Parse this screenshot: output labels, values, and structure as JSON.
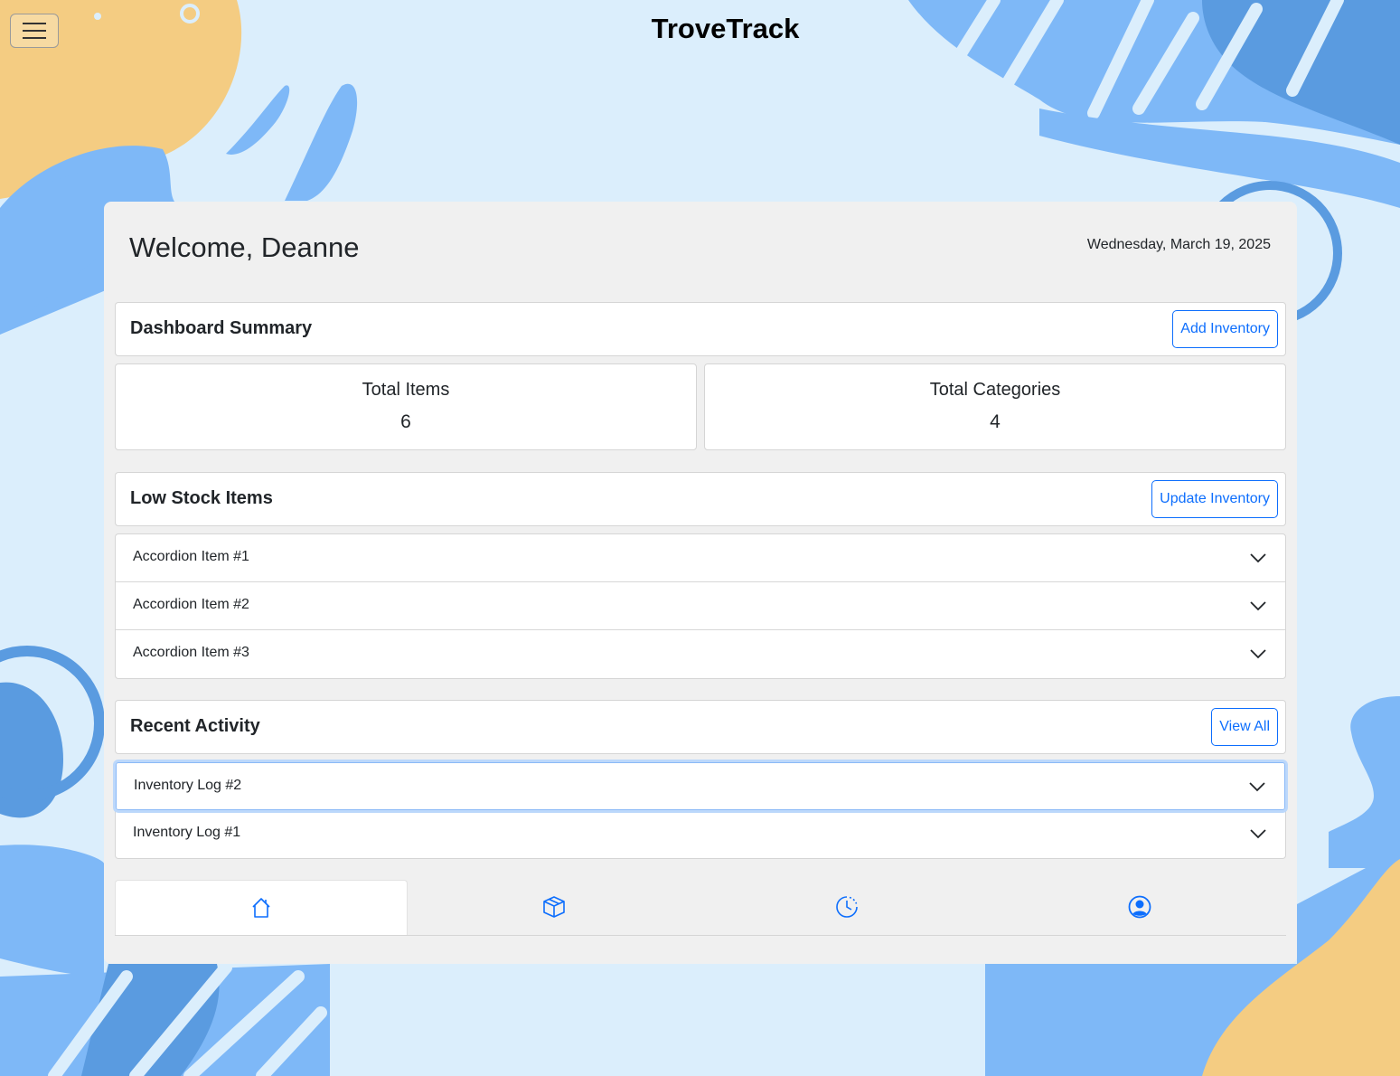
{
  "header": {
    "app_title": "TroveTrack",
    "menu_icon": "hamburger-menu-icon"
  },
  "dashboard": {
    "welcome": "Welcome, Deanne",
    "date": "Wednesday, March 19, 2025"
  },
  "summary": {
    "title": "Dashboard Summary",
    "button_label": "Add Inventory",
    "stats": [
      {
        "label": "Total Items",
        "value": "6"
      },
      {
        "label": "Total Categories",
        "value": "4"
      }
    ]
  },
  "low_stock": {
    "title": "Low Stock Items",
    "button_label": "Update Inventory",
    "items": [
      {
        "label": "Accordion Item #1"
      },
      {
        "label": "Accordion Item #2"
      },
      {
        "label": "Accordion Item #3"
      }
    ]
  },
  "recent_activity": {
    "title": "Recent Activity",
    "button_label": "View All",
    "items": [
      {
        "label": "Inventory Log #2"
      },
      {
        "label": "Inventory Log #1"
      }
    ]
  },
  "bottom_nav": {
    "tabs": [
      {
        "icon": "home-icon",
        "active": true
      },
      {
        "icon": "box-icon",
        "active": false
      },
      {
        "icon": "clock-history-icon",
        "active": false
      },
      {
        "icon": "user-circle-icon",
        "active": false
      }
    ]
  },
  "colors": {
    "accent": "#0d6efd",
    "background": "#dbeefc",
    "card": "#f0f0f0",
    "blob_blue": "#7eb8f7",
    "blob_dark_blue": "#5a9be0",
    "blob_orange": "#f4cc82"
  }
}
